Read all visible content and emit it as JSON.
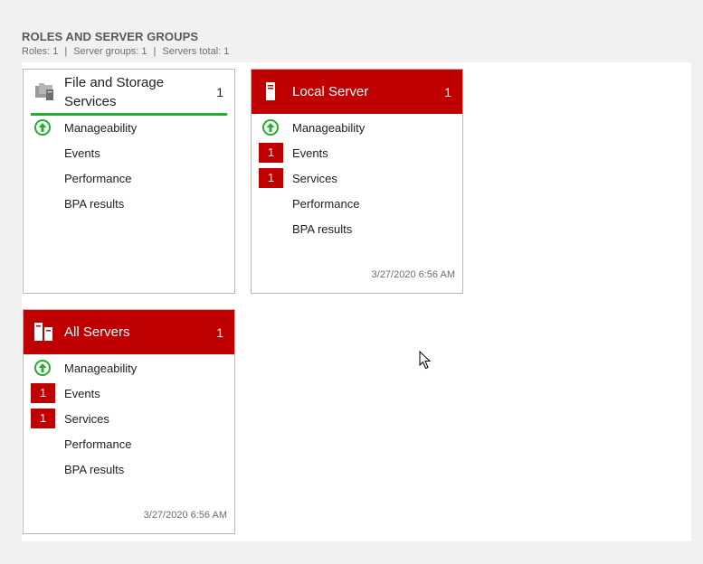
{
  "header": {
    "title": "ROLES AND SERVER GROUPS",
    "roles": "Roles: 1",
    "server_groups": "Server groups: 1",
    "servers_total": "Servers total: 1",
    "separator": "|"
  },
  "colors": {
    "alert_red": "#c00000",
    "ok_green": "#1fb02c",
    "tile_border": "#b8b8b8",
    "background": "#f1f1f1"
  },
  "tiles": {
    "file_storage": {
      "title_line1": "File and Storage",
      "title_line2": "Services",
      "count": "1",
      "icon": "folder-group-icon",
      "rows": {
        "manageability": "Manageability",
        "events": "Events",
        "performance": "Performance",
        "bpa": "BPA results"
      }
    },
    "local_server": {
      "title": "Local Server",
      "count": "1",
      "icon": "server-icon",
      "rows": {
        "manageability": "Manageability",
        "events": "Events",
        "events_badge": "1",
        "services": "Services",
        "services_badge": "1",
        "performance": "Performance",
        "bpa": "BPA results"
      },
      "timestamp": "3/27/2020 6:56 AM"
    },
    "all_servers": {
      "title": "All Servers",
      "count": "1",
      "icon": "servers-group-icon",
      "rows": {
        "manageability": "Manageability",
        "events": "Events",
        "events_badge": "1",
        "services": "Services",
        "services_badge": "1",
        "performance": "Performance",
        "bpa": "BPA results"
      },
      "timestamp": "3/27/2020 6:56 AM"
    }
  }
}
